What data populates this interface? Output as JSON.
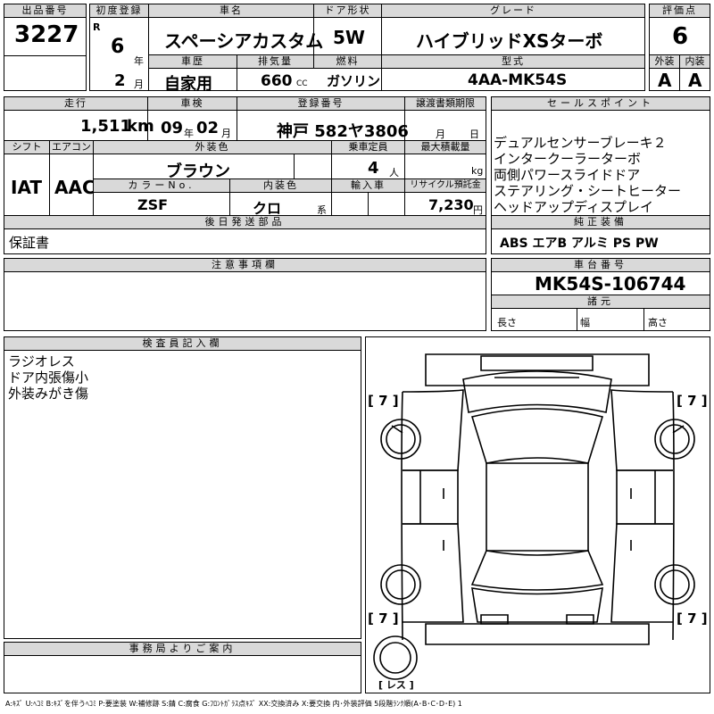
{
  "header_labels": {
    "lot_no": "出品番号",
    "first_reg": "初度登録",
    "car_name": "車名",
    "door": "ドア形状",
    "grade": "グレード",
    "score": "評価点",
    "history": "車歴",
    "displacement": "排気量",
    "fuel": "燃料",
    "model": "型式",
    "exterior": "外装",
    "interior": "内装"
  },
  "lot_no": "3227",
  "era": "R",
  "year": "6",
  "year_unit": "年",
  "month": "2",
  "month_unit": "月",
  "car_name": "スペーシアカスタム",
  "door": "5W",
  "grade": "ハイブリッドXSターボ",
  "score": "6",
  "history": "自家用",
  "displacement": "660",
  "cc_unit": "CC",
  "fuel": "ガソリン",
  "model": "4AA-MK54S",
  "ext_grade": "A",
  "int_grade": "A",
  "row2_labels": {
    "mileage": "走行",
    "inspection": "車検",
    "reg_no": "登録番号",
    "transfer": "譲渡書類期限",
    "sales": "セールスポイント"
  },
  "mileage": "1,511",
  "km_unit": "km",
  "insp_year": "09",
  "insp_month": "02",
  "reg_no": "神戸 582ヤ3806",
  "transfer_month": "月",
  "transfer_day": "日",
  "row3_labels": {
    "shift": "シフト",
    "aircon": "エアコン",
    "ext_color": "外装色",
    "capacity": "乗車定員",
    "load": "最大積載量",
    "color_no": "カラーNo.",
    "int_color": "内装色",
    "import": "輸入車",
    "recycle": "リサイクル預託金"
  },
  "shift": "IAT",
  "aircon": "AAC",
  "ext_color": "ブラウン",
  "capacity": "4",
  "capacity_unit": "人",
  "load_unit": "kg",
  "color_no": "ZSF",
  "int_color": "クロ",
  "int_color_unit": "系",
  "recycle": "7,230",
  "yen_unit": "円",
  "sales_points": [
    "デュアルセンサーブレーキ２",
    "インタークーラーターボ",
    "両側パワースライドドア",
    "ステアリング・シートヒーター",
    "ヘッドアップディスプレイ"
  ],
  "later_parts_label": "後日発送部品",
  "later_parts": "保証書",
  "equipment_label": "純正装備",
  "equipment": "ABS エアB アルミ PS PW",
  "notes_label": "注意事項欄",
  "chassis_label": "車台番号",
  "chassis": "MK54S-106744",
  "specs_label": "諸元",
  "length_label": "長さ",
  "width_label": "幅",
  "height_label": "高さ",
  "inspector_label": "検査員記入欄",
  "inspector_notes": [
    "ラジオレス",
    "ドア内張傷小",
    "外装みがき傷"
  ],
  "office_label": "事務局よりご案内",
  "tire_marks": {
    "fl": "[ 7 ]",
    "fr": "[ 7 ]",
    "rl": "[ 7 ]",
    "rr": "[ 7 ]"
  },
  "spare": "[ レス ]",
  "legend": "A:ｷｽﾞ U:ﾍｺﾐ B:ｷｽﾞを伴うﾍｺﾐ P:要塗装 W:補修跡 S:錆 C:腐食 G:ﾌﾛﾝﾄｶﾞﾗｽ点ｷｽﾞ XX:交換済み X:要交換 内･外装評価 5段階ﾗﾝｸ順(A･B･C･D･E) 1"
}
